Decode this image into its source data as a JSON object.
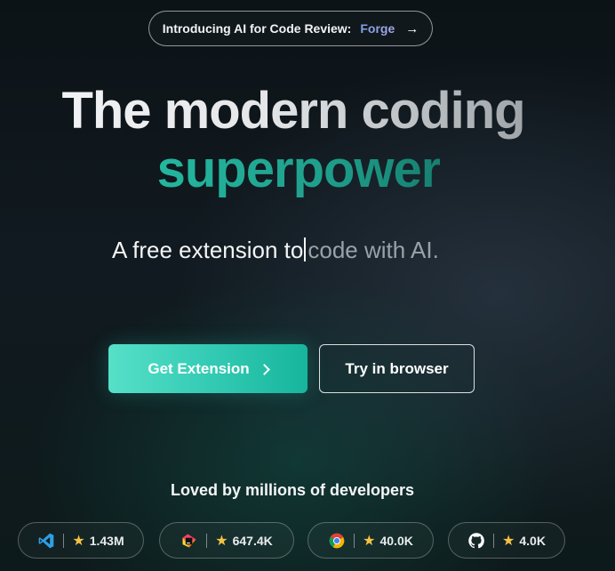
{
  "announcement": {
    "text": "Introducing AI for Code Review:",
    "highlight": "Forge",
    "arrow_icon": "arrow-right-icon"
  },
  "hero": {
    "headline_line1": "The modern coding",
    "headline_line2": "superpower",
    "tagline_typed": "A free extension to",
    "tagline_rest": "code with AI."
  },
  "actions": {
    "primary_label": "Get Extension",
    "primary_icon": "chevron-right-icon",
    "secondary_label": "Try in browser"
  },
  "social": {
    "heading": "Loved by millions of developers",
    "badges": [
      {
        "platform_icon": "vscode-icon",
        "rating_icon": "star-icon",
        "count": "1.43M"
      },
      {
        "platform_icon": "jetbrains-icon",
        "rating_icon": "star-icon",
        "count": "647.4K"
      },
      {
        "platform_icon": "chrome-icon",
        "rating_icon": "star-icon",
        "count": "40.0K"
      },
      {
        "platform_icon": "github-icon",
        "rating_icon": "star-icon",
        "count": "4.0K"
      }
    ]
  },
  "colors": {
    "accent_teal": "#1fb39b",
    "button_gradient_start": "#56e0c8",
    "star": "#f6c244",
    "background": "#0f171c"
  }
}
